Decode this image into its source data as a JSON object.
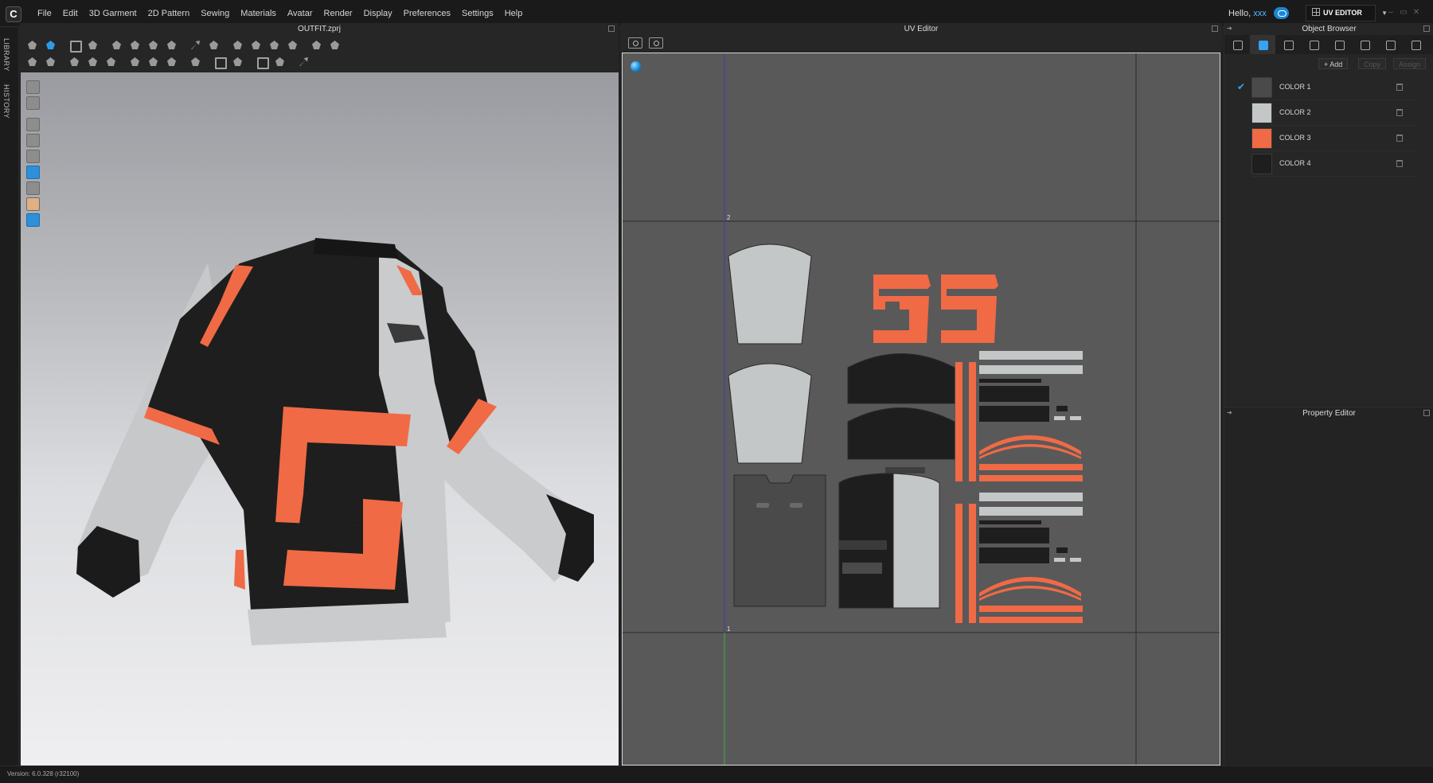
{
  "menubar": {
    "logo": "C",
    "menus": [
      "File",
      "Edit",
      "3D Garment",
      "2D Pattern",
      "Sewing",
      "Materials",
      "Avatar",
      "Render",
      "Display",
      "Preferences",
      "Settings",
      "Help"
    ],
    "greeting": "Hello,",
    "username": "xxx",
    "mode": "UV EDITOR"
  },
  "left_strip": {
    "tabs": [
      "LIBRARY",
      "HISTORY"
    ]
  },
  "panel3d": {
    "title": "OUTFIT.zprj"
  },
  "uv_editor": {
    "title": "UV Editor",
    "tile_labels": [
      "2",
      "1"
    ],
    "colors": {
      "light": "#c4c7c8",
      "dark": "#1e1e1e",
      "orange": "#f06a45",
      "mid": "#4a4a4a"
    }
  },
  "object_browser": {
    "title": "Object Browser",
    "actions": {
      "add": "+ Add",
      "copy": "Copy",
      "assign": "Assign"
    },
    "colors": [
      {
        "name": "COLOR 1",
        "hex": "#4a4a4a",
        "selected": true
      },
      {
        "name": "COLOR 2",
        "hex": "#c4c7c8",
        "selected": false
      },
      {
        "name": "COLOR 3",
        "hex": "#f06a45",
        "selected": false
      },
      {
        "name": "COLOR 4",
        "hex": "#1e1e1e",
        "selected": false
      }
    ]
  },
  "property_editor": {
    "title": "Property Editor"
  },
  "statusbar": {
    "version": "Version: 6.0.328 (r32100)"
  }
}
